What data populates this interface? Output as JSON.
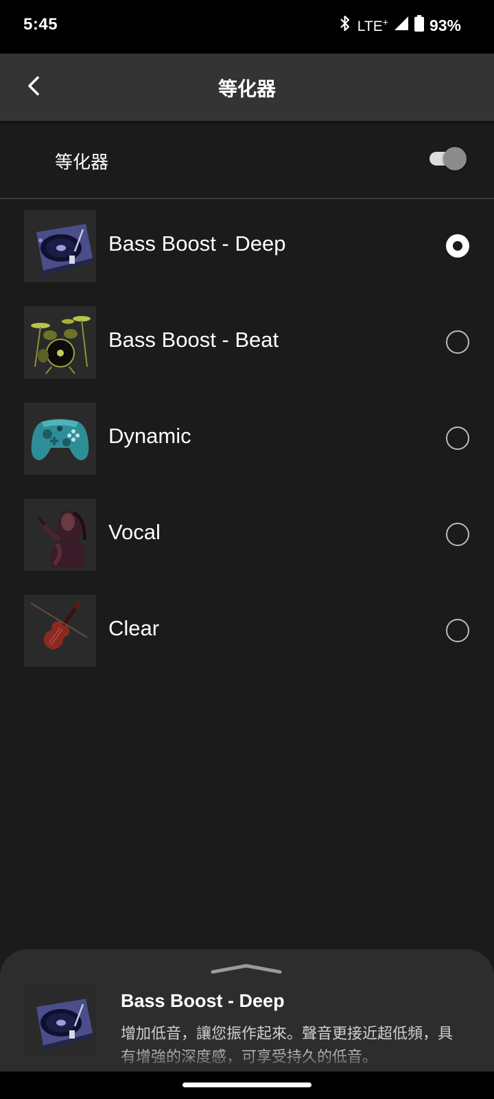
{
  "status_bar": {
    "time": "5:45",
    "network": "LTE",
    "network_suffix": "+",
    "battery": "93%"
  },
  "app_bar": {
    "title": "等化器"
  },
  "equalizer": {
    "label": "等化器",
    "enabled": true
  },
  "presets": [
    {
      "name": "Bass Boost - Deep",
      "selected": true,
      "icon": "turntable-icon"
    },
    {
      "name": "Bass Boost - Beat",
      "selected": false,
      "icon": "drum-kit-icon"
    },
    {
      "name": "Dynamic",
      "selected": false,
      "icon": "game-controller-icon"
    },
    {
      "name": "Vocal",
      "selected": false,
      "icon": "singer-icon"
    },
    {
      "name": "Clear",
      "selected": false,
      "icon": "violin-icon"
    }
  ],
  "bottom_sheet": {
    "title": "Bass Boost - Deep",
    "description": "增加低音，讓您振作起來。聲音更接近超低頻，具有增強的深度感，可享受持久的低音。"
  },
  "colors": {
    "background": "#1b1b1b",
    "app_bar": "#343434",
    "sheet": "#2d2d2d"
  }
}
